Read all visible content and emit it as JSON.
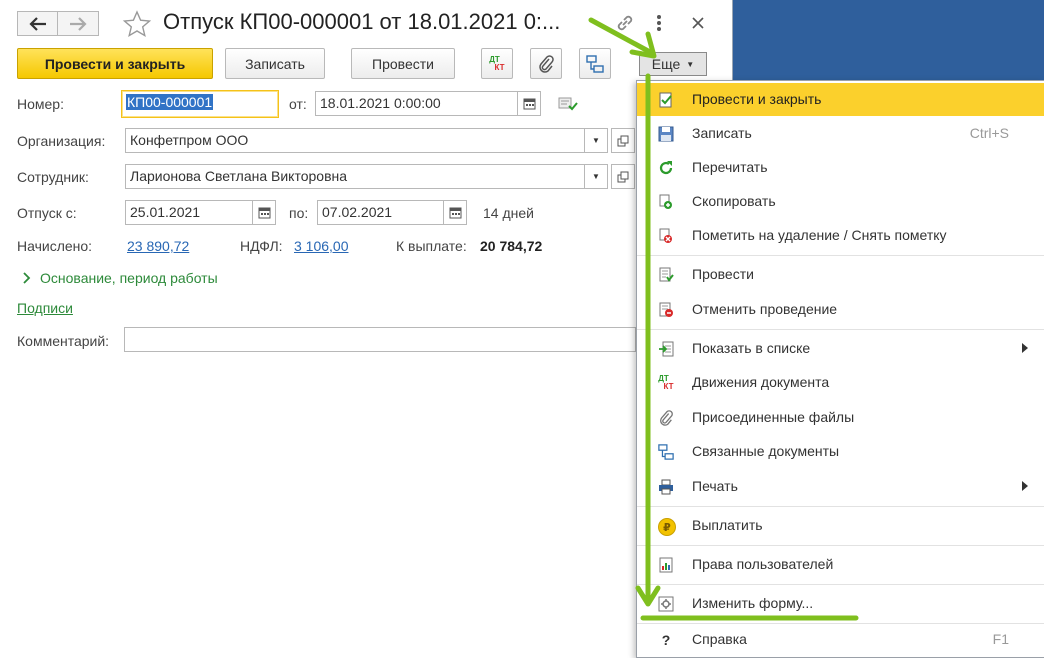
{
  "window": {
    "title": "Отпуск КП00-000001 от 18.01.2021 0:..."
  },
  "toolbar": {
    "post_close": "Провести и закрыть",
    "save": "Записать",
    "post": "Провести",
    "dtkt_top": "ДТ",
    "dtkt_bottom": "КТ",
    "more": "Еще"
  },
  "form": {
    "number_label": "Номер:",
    "number_value": "КП00-000001",
    "date_label": "от:",
    "date_value": "18.01.2021  0:00:00",
    "org_label": "Организация:",
    "org_value": "Конфетпром ООО",
    "employee_label": "Сотрудник:",
    "employee_value": "Ларионова Светлана Викторовна",
    "vacation_from_label": "Отпуск с:",
    "vacation_from_value": "25.01.2021",
    "vacation_to_label": "по:",
    "vacation_to_value": "07.02.2021",
    "days": "14 дней",
    "accrued_label": "Начислено:",
    "accrued_value": "23 890,72",
    "ndfl_label": "НДФЛ:",
    "ndfl_value": "3 106,00",
    "payout_label": "К выплате:",
    "payout_value": "20 784,72",
    "basis_group": "Основание, период работы",
    "signatures_link": "Подписи",
    "comment_label": "Комментарий:",
    "comment_value": ""
  },
  "menu": {
    "items": [
      {
        "label": "Провести и закрыть",
        "shortcut": ""
      },
      {
        "label": "Записать",
        "shortcut": "Ctrl+S"
      },
      {
        "label": "Перечитать",
        "shortcut": ""
      },
      {
        "label": "Скопировать",
        "shortcut": ""
      },
      {
        "label": "Пометить на удаление / Снять пометку",
        "shortcut": ""
      },
      {
        "label": "Провести",
        "shortcut": ""
      },
      {
        "label": "Отменить проведение",
        "shortcut": ""
      },
      {
        "label": "Показать в списке",
        "shortcut": ""
      },
      {
        "label": "Движения документа",
        "shortcut": ""
      },
      {
        "label": "Присоединенные файлы",
        "shortcut": ""
      },
      {
        "label": "Связанные документы",
        "shortcut": ""
      },
      {
        "label": "Печать",
        "shortcut": ""
      },
      {
        "label": "Выплатить",
        "shortcut": ""
      },
      {
        "label": "Права пользователей",
        "shortcut": ""
      },
      {
        "label": "Изменить форму...",
        "shortcut": ""
      },
      {
        "label": "Справка",
        "shortcut": "F1"
      }
    ],
    "dtkt_top": "ДТ",
    "dtkt_bottom": "КТ",
    "help_glyph": "?",
    "pay_glyph": "₽"
  },
  "colors": {
    "accent_yellow": "#fbd02c",
    "annotation_green": "#7fbf1e",
    "link_blue": "#2867b4",
    "desktop_blue": "#2f5f9c"
  }
}
